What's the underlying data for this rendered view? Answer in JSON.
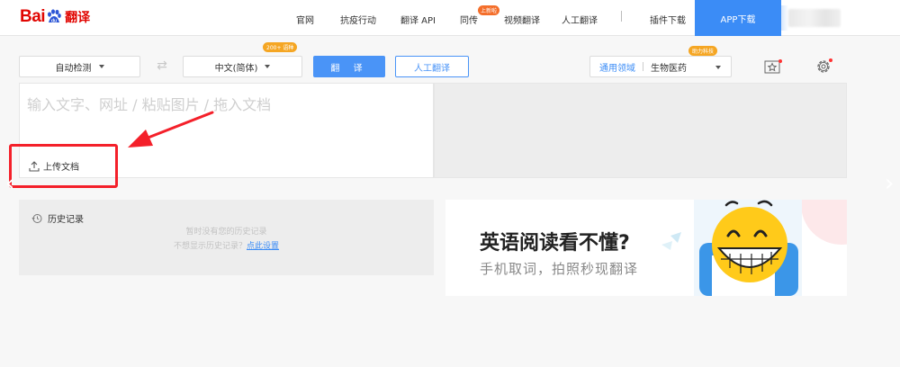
{
  "logo": {
    "text": "Bai",
    "du": "du",
    "suffix": "翻译"
  },
  "nav": {
    "items": [
      "官网",
      "抗疫行动",
      "翻译 API",
      "同传",
      "视频翻译",
      "人工翻译",
      "插件下载"
    ],
    "badge": "上新啦",
    "app_download": "APP下载"
  },
  "toolbar": {
    "source_lang": "自动检测",
    "swap_icon": "⇄",
    "target_lang": "中文(简体)",
    "lang_badge": "200+ 语种",
    "translate_label": "翻 译",
    "human_translate_label": "人工翻译",
    "domain_label": "通用领域",
    "domain_value": "生物医药",
    "domain_badge": "助力科技"
  },
  "input": {
    "placeholder": "输入文字、网址 / 粘贴图片 / 拖入文档",
    "upload_label": "上传文档"
  },
  "history": {
    "title": "历史记录",
    "empty_message": "暂时没有您的历史记录",
    "hint_text": "不想显示历史记录？",
    "settings_link": "点此设置"
  },
  "ad": {
    "headline": "英语阅读看不懂?",
    "subline": "手机取词，拍照秒现翻译"
  },
  "colors": {
    "brand_red": "#e10602",
    "accent_blue": "#4a94f7",
    "badge_orange": "#f5a623",
    "annotation_red": "#f4202a"
  }
}
